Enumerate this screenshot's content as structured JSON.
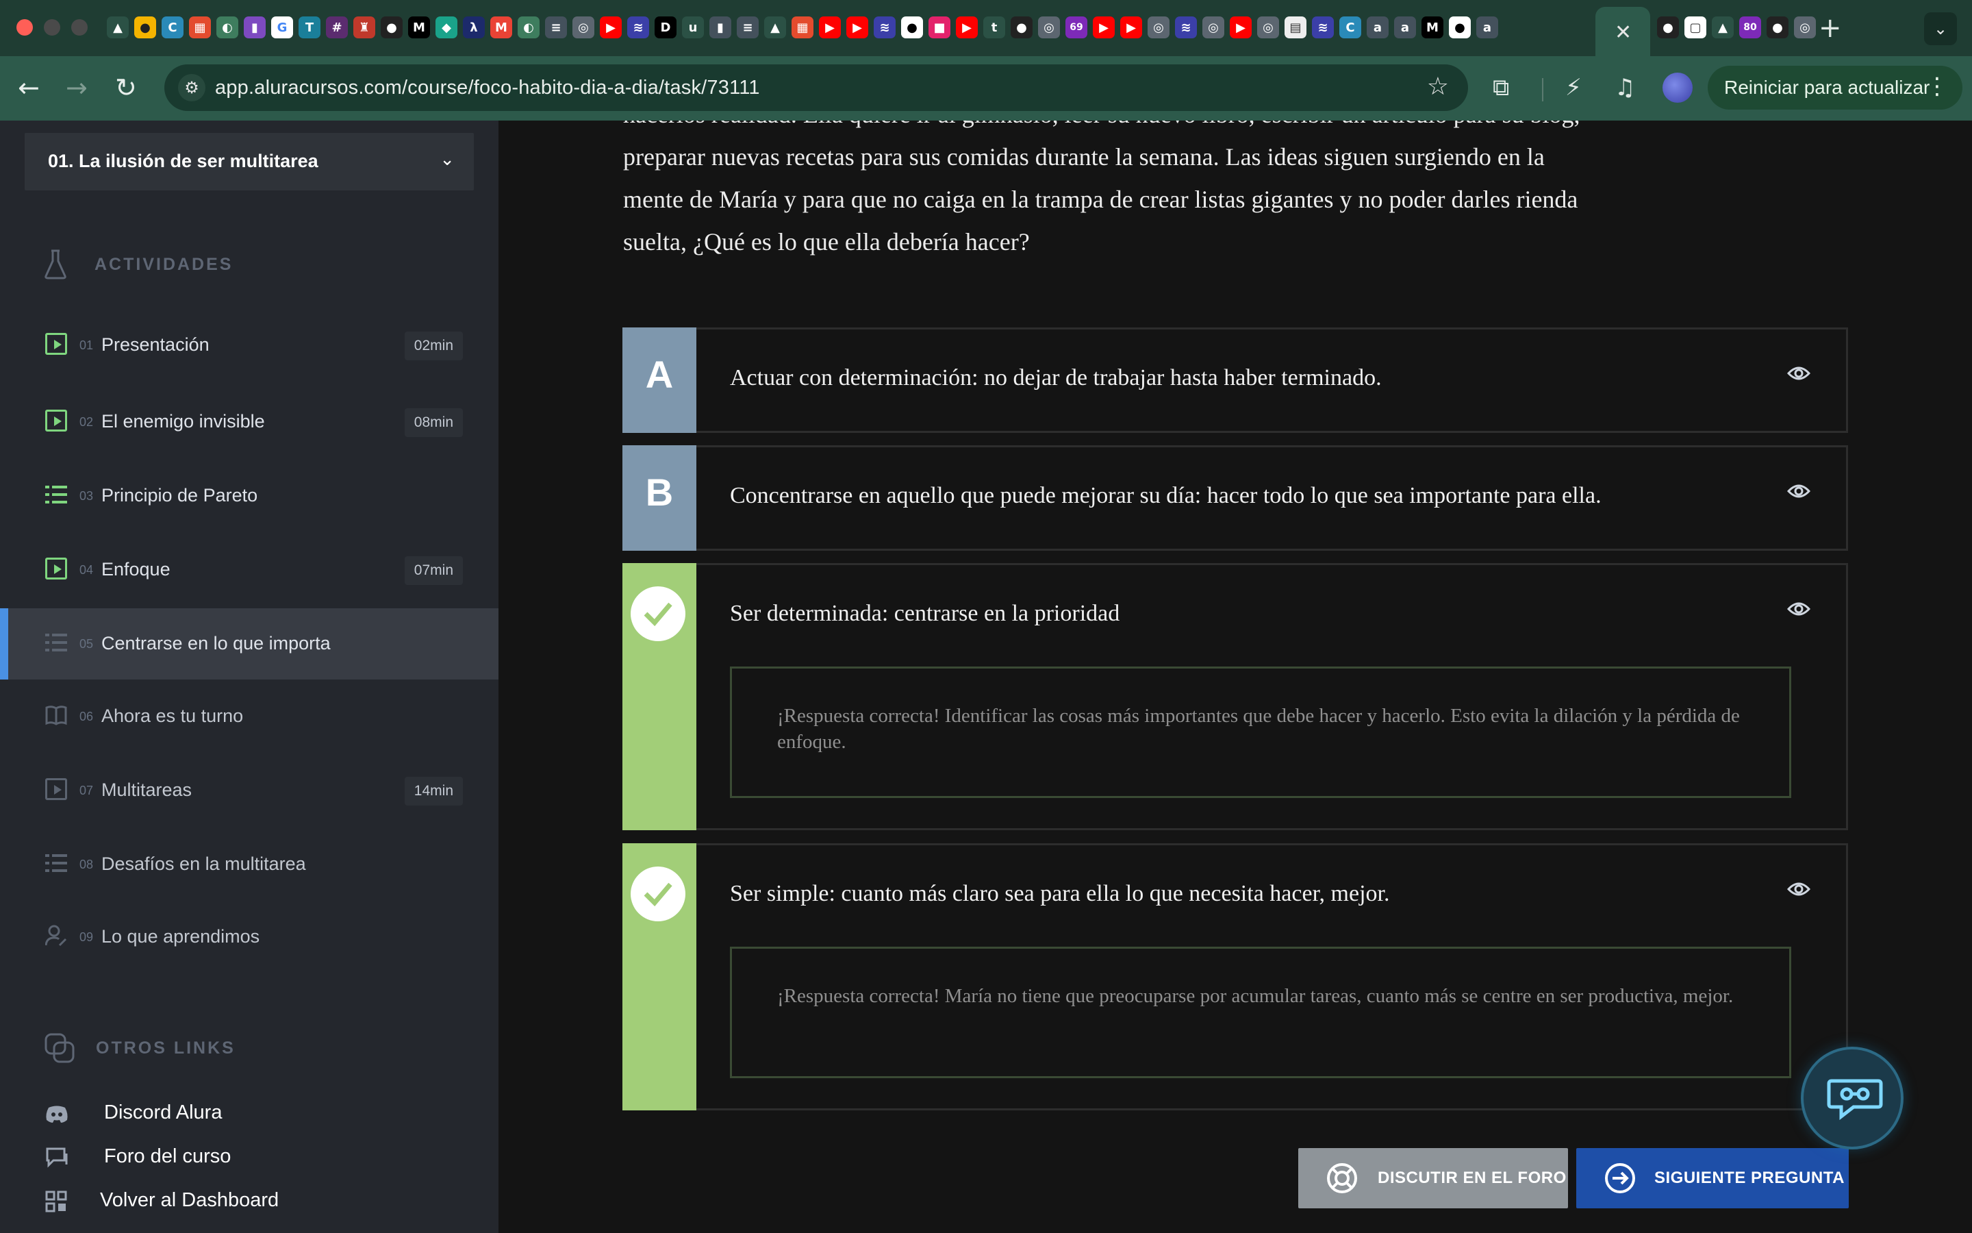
{
  "browser": {
    "url": "app.aluracursos.com/course/foco-habito-dia-a-dia/task/73111",
    "update_label": "Reiniciar para actualizar",
    "tab_badges": [
      "69",
      "80"
    ]
  },
  "sidebar": {
    "section_title": "01. La ilusión de ser multitarea",
    "activities_heading": "ACTIVIDADES",
    "activities": [
      {
        "num": "01",
        "title": "Presentación",
        "duration": "02min",
        "icon": "play-icon",
        "done": true
      },
      {
        "num": "02",
        "title": "El enemigo invisible",
        "duration": "08min",
        "icon": "play-icon",
        "done": true
      },
      {
        "num": "03",
        "title": "Principio de Pareto",
        "duration": "",
        "icon": "list-icon",
        "done": true
      },
      {
        "num": "04",
        "title": "Enfoque",
        "duration": "07min",
        "icon": "play-icon",
        "done": true
      },
      {
        "num": "05",
        "title": "Centrarse en lo que importa",
        "duration": "",
        "icon": "list-icon",
        "done": false,
        "active": true
      },
      {
        "num": "06",
        "title": "Ahora es tu turno",
        "duration": "",
        "icon": "book-icon",
        "done": false
      },
      {
        "num": "07",
        "title": "Multitareas",
        "duration": "14min",
        "icon": "play-icon",
        "done": false
      },
      {
        "num": "08",
        "title": "Desafíos en la multitarea",
        "duration": "",
        "icon": "list-icon",
        "done": false
      },
      {
        "num": "09",
        "title": "Lo que aprendimos",
        "duration": "",
        "icon": "person-icon",
        "done": false
      }
    ],
    "links_heading": "OTROS LINKS",
    "links": [
      {
        "label": "Discord Alura",
        "icon": "discord-icon"
      },
      {
        "label": "Foro del curso",
        "icon": "forum-icon"
      },
      {
        "label": "Volver al Dashboard",
        "icon": "dashboard-icon"
      }
    ]
  },
  "question": {
    "text_line0": "hacerlos realidad. Ella quiere ir al gimnasio, leer su nuevo libro, escribir un artículo para su blog,",
    "text_line1": "preparar nuevas recetas para sus comidas durante la semana. Las ideas siguen surgiendo en la",
    "text_line2": "mente de María y para que no caiga en la trampa de crear listas gigantes y no poder darles rienda",
    "text_line3": "suelta, ¿Qué es lo que ella debería hacer?"
  },
  "options": [
    {
      "letter": "A",
      "text": "Actuar con determinación: no dejar de trabajar hasta haber terminado.",
      "correct": false
    },
    {
      "letter": "B",
      "text": "Concentrarse en aquello que puede mejorar su día: hacer todo lo que sea importante para ella.",
      "correct": false
    },
    {
      "letter": "",
      "text": "Ser determinada: centrarse en la prioridad",
      "correct": true,
      "feedback": "¡Respuesta correcta! Identificar las cosas más importantes que debe hacer y hacerlo. Esto evita la dilación y la pérdida de enfoque."
    },
    {
      "letter": "",
      "text": "Ser simple: cuanto más claro sea para ella lo que necesita hacer, mejor.",
      "correct": true,
      "feedback": "¡Respuesta correcta! María no tiene que preocuparse por acumular tareas, cuanto más se centre en ser productiva, mejor."
    }
  ],
  "actions": {
    "forum_label": "DISCUTIR EN EL FORO",
    "next_label": "SIGUIENTE PREGUNTA"
  },
  "colors": {
    "accent_blue": "#1e4fa8",
    "correct_green": "#a2ce78",
    "letter_blue": "#7e97ad",
    "sidebar_active_bar": "#4a90e2",
    "done_icon_green": "#7fd67f"
  }
}
